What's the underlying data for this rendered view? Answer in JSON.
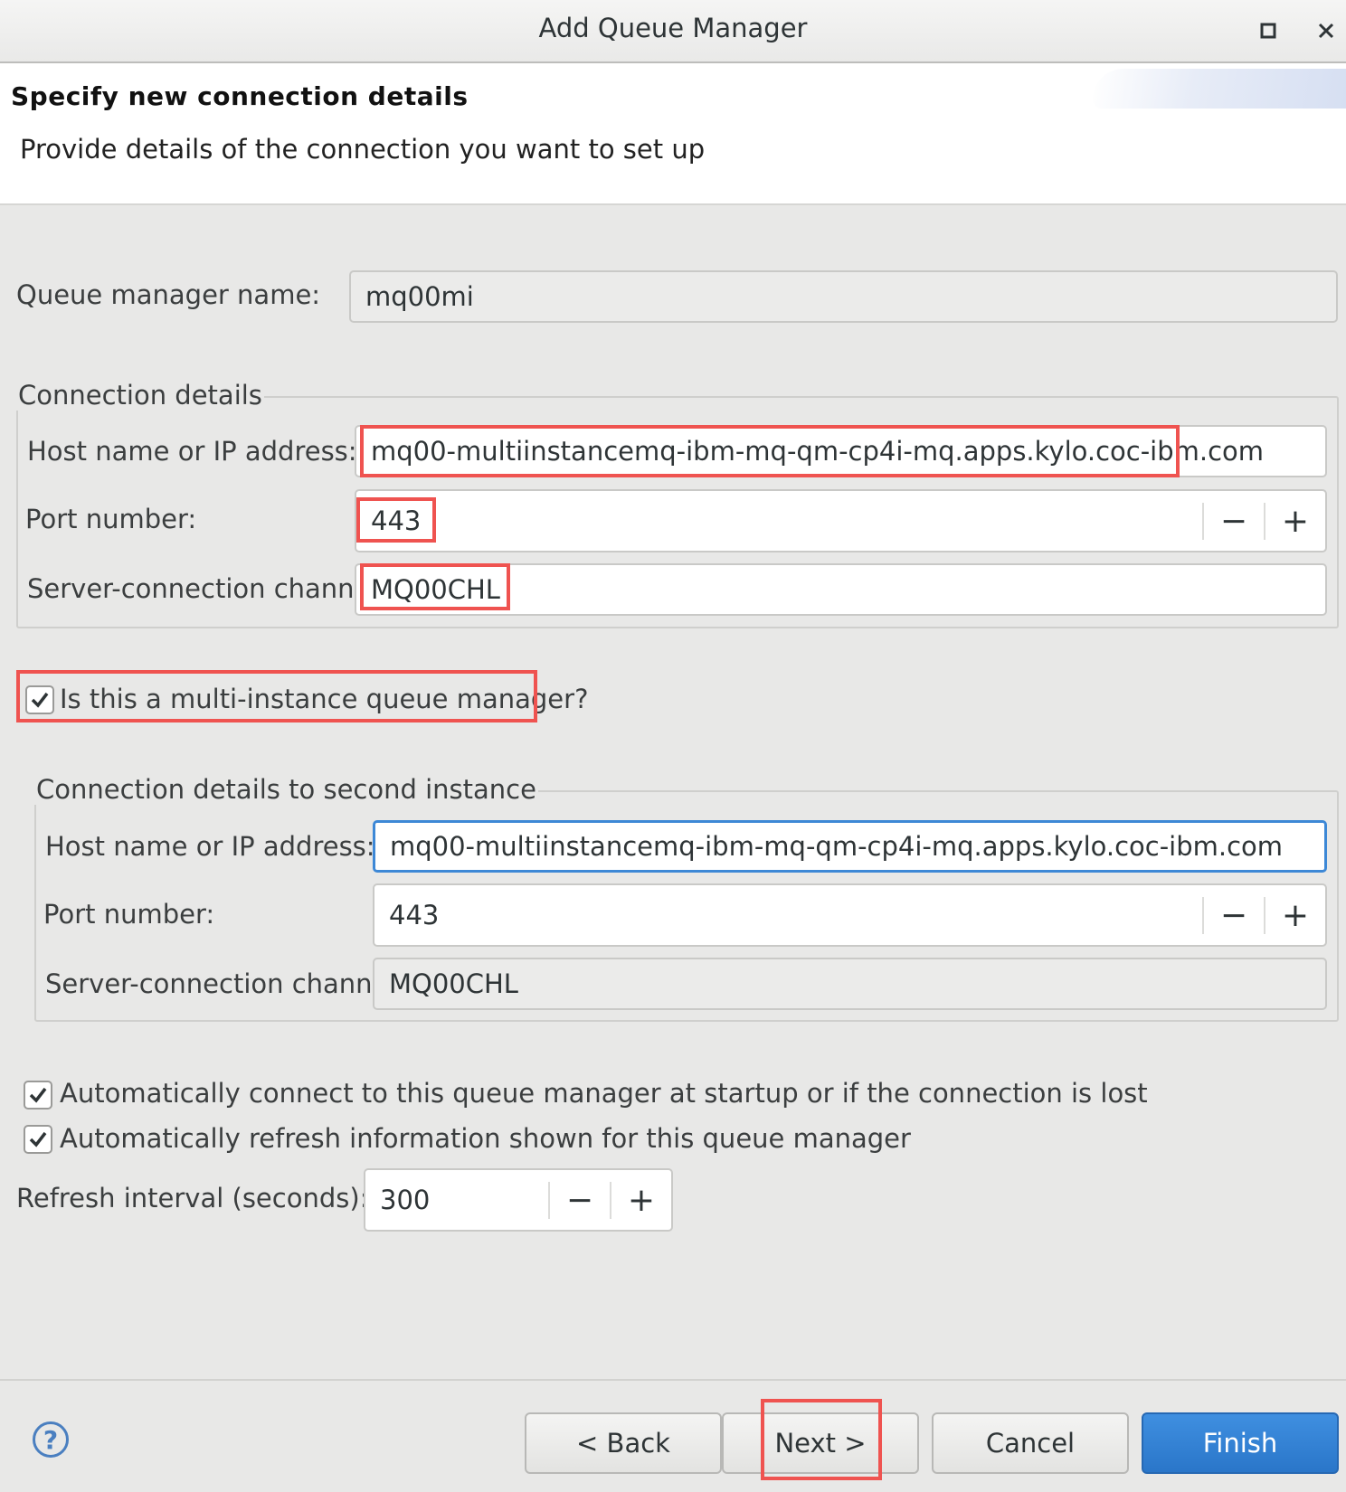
{
  "window": {
    "title": "Add Queue Manager",
    "maximize_icon": "maximize-icon",
    "close_icon": "close-icon"
  },
  "header": {
    "title": "Specify new connection details",
    "description": "Provide details of the connection you want to set up"
  },
  "queue_manager": {
    "label": "Queue manager name:",
    "value": "mq00mi"
  },
  "connection": {
    "legend": "Connection details",
    "host_label": "Host name or IP address:",
    "host_value": "mq00-multiinstancemq-ibm-mq-qm-cp4i-mq.apps.kylo.coc-ibm.com",
    "port_label": "Port number:",
    "port_value": "443",
    "channel_label": "Server-connection channel:",
    "channel_value": "MQ00CHL"
  },
  "multi_instance": {
    "label": "Is this a multi-instance queue manager?",
    "checked": true
  },
  "second_instance": {
    "legend": "Connection details to second instance",
    "host_label": "Host name or IP address:",
    "host_value": "mq00-multiinstancemq-ibm-mq-qm-cp4i-mq.apps.kylo.coc-ibm.com",
    "port_label": "Port number:",
    "port_value": "443",
    "channel_label": "Server-connection channel:",
    "channel_value": "MQ00CHL"
  },
  "options": {
    "auto_connect_label": "Automatically connect to this queue manager at startup or if the connection is lost",
    "auto_refresh_label": "Automatically refresh information shown for this queue manager",
    "refresh_label": "Refresh interval (seconds):",
    "refresh_value": "300"
  },
  "spinner": {
    "minus": "−",
    "plus": "+"
  },
  "buttons": {
    "help": "?",
    "back": "< Back",
    "next": "Next >",
    "cancel": "Cancel",
    "finish": "Finish"
  },
  "colors": {
    "highlight": "#ef5350",
    "primary": "#2a76c9",
    "focus": "#3d88d6"
  }
}
